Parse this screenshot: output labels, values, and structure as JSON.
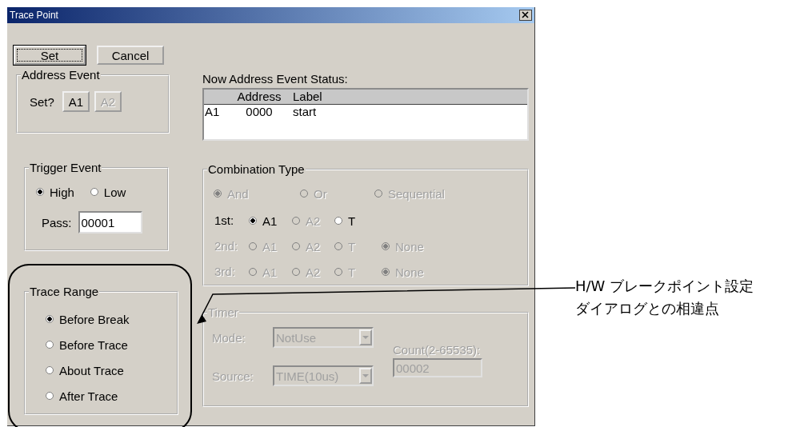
{
  "window": {
    "title": "Trace Point"
  },
  "buttons": [
    {
      "label": "Set",
      "focused": true
    },
    {
      "label": "Cancel",
      "focused": false
    }
  ],
  "address_event": {
    "title": "Address Event",
    "prompt": "Set?",
    "buttons": [
      {
        "label": "A1",
        "disabled": false
      },
      {
        "label": "A2",
        "disabled": true
      }
    ]
  },
  "trigger_event": {
    "title": "Trigger Event",
    "options": [
      {
        "label": "High",
        "selected": true
      },
      {
        "label": "Low",
        "selected": false
      }
    ],
    "pass_label": "Pass:",
    "pass_value": "00001"
  },
  "trace_range": {
    "title": "Trace Range",
    "options": [
      {
        "label": "Before Break",
        "selected": true
      },
      {
        "label": "Before Trace",
        "selected": false
      },
      {
        "label": "About Trace",
        "selected": false
      },
      {
        "label": "After Trace",
        "selected": false
      }
    ]
  },
  "status": {
    "label": "Now Address Event Status:",
    "columns": [
      "",
      "Address",
      "Label"
    ],
    "rows": [
      [
        "A1",
        "0000",
        "start"
      ]
    ]
  },
  "combination_type": {
    "title": "Combination Type",
    "logic": [
      {
        "label": "And",
        "selected": true,
        "disabled": true
      },
      {
        "label": "Or",
        "selected": false,
        "disabled": true
      },
      {
        "label": "Sequential",
        "selected": false,
        "disabled": true
      }
    ],
    "slots": [
      {
        "label": "1st:",
        "disabled": false,
        "options": [
          {
            "label": "A1",
            "selected": true,
            "disabled": false
          },
          {
            "label": "A2",
            "selected": false,
            "disabled": true
          },
          {
            "label": "T",
            "selected": false,
            "disabled": false
          }
        ]
      },
      {
        "label": "2nd:",
        "disabled": true,
        "options": [
          {
            "label": "A1",
            "selected": false,
            "disabled": true
          },
          {
            "label": "A2",
            "selected": false,
            "disabled": true
          },
          {
            "label": "T",
            "selected": false,
            "disabled": true
          },
          {
            "label": "None",
            "selected": true,
            "disabled": true
          }
        ]
      },
      {
        "label": "3rd:",
        "disabled": true,
        "options": [
          {
            "label": "A1",
            "selected": false,
            "disabled": true
          },
          {
            "label": "A2",
            "selected": false,
            "disabled": true
          },
          {
            "label": "T",
            "selected": false,
            "disabled": true
          },
          {
            "label": "None",
            "selected": true,
            "disabled": true
          }
        ]
      }
    ]
  },
  "timer": {
    "title": "Timer",
    "disabled": true,
    "mode_label": "Mode:",
    "mode_value": "NotUse",
    "source_label": "Source:",
    "source_value": "TIME(10us)",
    "count_label": "Count(2-65535):",
    "count_value": "00002"
  },
  "annotation": {
    "lines": [
      "H/W ブレークポイント設定",
      "ダイアログとの相違点"
    ]
  }
}
